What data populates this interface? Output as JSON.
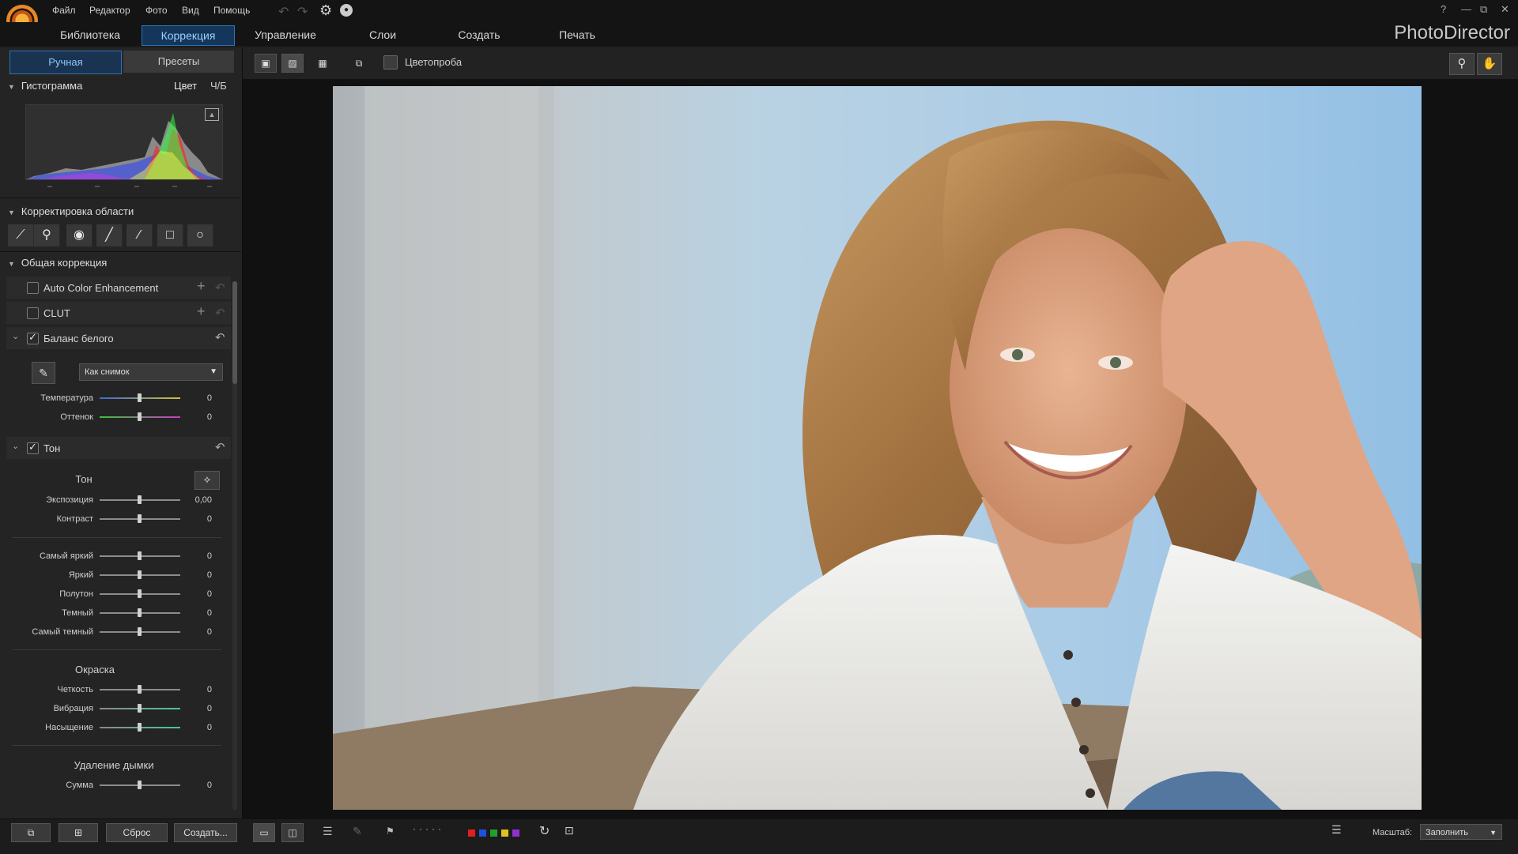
{
  "menu": {
    "items": [
      "Файл",
      "Редактор",
      "Фото",
      "Вид",
      "Помощь"
    ]
  },
  "window_controls": [
    "?",
    "—",
    "⧉",
    "✕"
  ],
  "modules": {
    "tabs": [
      "Библиотека",
      "Коррекция",
      "Управление",
      "Слои",
      "Создать",
      "Печать"
    ],
    "active": "Коррекция"
  },
  "brand": "PhotoDirector",
  "left_panel": {
    "tabs": [
      "Ручная",
      "Пресеты"
    ],
    "histogram": {
      "title": "Гистограмма",
      "mode_color": "Цвет",
      "mode_bw": "Ч/Б",
      "ticks": [
        "–",
        "–",
        "–",
        "–",
        "–"
      ]
    },
    "regional": {
      "title": "Корректировка области"
    },
    "global": {
      "title": "Общая коррекция",
      "auto_color": "Auto Color Enhancement",
      "clut": "CLUT",
      "white_balance": {
        "title": "Баланс белого",
        "preset": "Как снимок",
        "sliders": [
          {
            "label": "Температура",
            "value": "0"
          },
          {
            "label": "Оттенок",
            "value": "0"
          }
        ]
      },
      "tone": {
        "title": "Тон",
        "sub_tone": "Тон",
        "sliders_top": [
          {
            "label": "Экспозиция",
            "value": "0,00"
          },
          {
            "label": "Контраст",
            "value": "0"
          }
        ],
        "sliders_mid": [
          {
            "label": "Самый яркий",
            "value": "0"
          },
          {
            "label": "Яркий",
            "value": "0"
          },
          {
            "label": "Полутон",
            "value": "0"
          },
          {
            "label": "Темный",
            "value": "0"
          },
          {
            "label": "Самый темный",
            "value": "0"
          }
        ],
        "sub_color": "Окраска",
        "sliders_color": [
          {
            "label": "Четкость",
            "value": "0"
          },
          {
            "label": "Вибрация",
            "value": "0"
          },
          {
            "label": "Насыщение",
            "value": "0"
          }
        ],
        "sub_dehaze": "Удаление дымки",
        "sliders_dehaze": [
          {
            "label": "Сумма",
            "value": "0"
          }
        ]
      }
    },
    "bottom": {
      "reset": "Сброс",
      "create": "Создать..."
    }
  },
  "view_toolbar": {
    "softproof": "Цветопроба"
  },
  "bottom_bar": {
    "zoom_label": "Масштаб:",
    "zoom_value": "Заполнить",
    "color_labels": [
      "#e02020",
      "#2050e0",
      "#20a030",
      "#e0c020",
      "#9030d0"
    ]
  },
  "colors": {
    "accent": "#2d74b8",
    "accent_text": "#9fd0ff"
  }
}
